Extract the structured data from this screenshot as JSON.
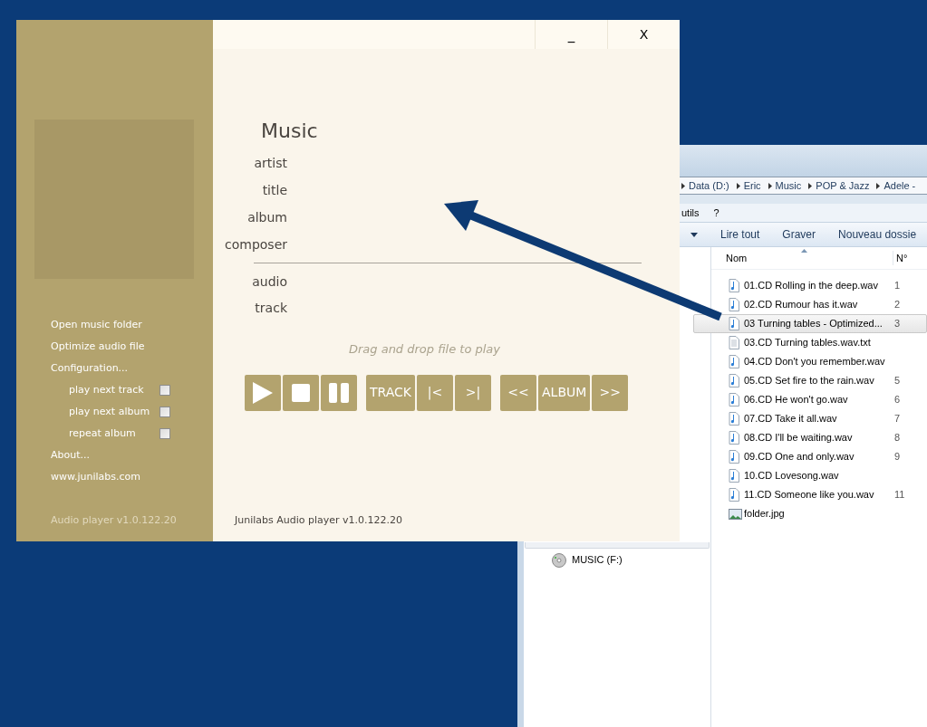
{
  "explorer": {
    "breadcrumb": [
      "Data (D:)",
      "Eric",
      "Music",
      "POP & Jazz",
      "Adele -"
    ],
    "menu": [
      "utils",
      "?"
    ],
    "toolbar": [
      {
        "kind": "dropdown"
      },
      {
        "kind": "text",
        "label": "Lire tout"
      },
      {
        "kind": "text",
        "label": "Graver"
      },
      {
        "kind": "text",
        "label": "Nouveau dossie"
      }
    ],
    "columns": [
      "Nom",
      "N°"
    ],
    "files": [
      {
        "name": "01.CD Rolling in the deep.wav",
        "number": "1",
        "kind": "audio",
        "selected": false
      },
      {
        "name": "02.CD Rumour has it.wav",
        "number": "2",
        "kind": "audio",
        "selected": false
      },
      {
        "name": "03 Turning tables - Optimized...",
        "number": "3",
        "kind": "audio",
        "selected": true
      },
      {
        "name": "03.CD Turning tables.wav.txt",
        "kind": "text",
        "selected": false
      },
      {
        "name": "04.CD Don't you remember.wav",
        "kind": "audio",
        "selected": false
      },
      {
        "name": "05.CD Set fire to the rain.wav",
        "number": "5",
        "kind": "audio",
        "selected": false
      },
      {
        "name": "06.CD He won't go.wav",
        "number": "6",
        "kind": "audio",
        "selected": false
      },
      {
        "name": "07.CD Take it all.wav",
        "number": "7",
        "kind": "audio",
        "selected": false
      },
      {
        "name": "08.CD I'll be waiting.wav",
        "number": "8",
        "kind": "audio",
        "selected": false
      },
      {
        "name": "09.CD One and only.wav",
        "number": "9",
        "kind": "audio",
        "selected": false
      },
      {
        "name": "10.CD Lovesong.wav",
        "kind": "audio",
        "selected": false
      },
      {
        "name": "11.CD Someone like you.wav",
        "number": "11",
        "kind": "audio",
        "selected": false
      },
      {
        "name": "folder.jpg",
        "kind": "image",
        "selected": false
      }
    ],
    "nav_items": [
      {
        "label": "MUSIC (F:)",
        "kind": "disc",
        "selected": false
      }
    ]
  },
  "player": {
    "window_controls": [
      "_",
      "X"
    ],
    "sidebar": {
      "menu": [
        {
          "label": "Open music folder",
          "kind": "link"
        },
        {
          "label": "Optimize audio file",
          "kind": "link"
        },
        {
          "label": "Configuration...",
          "kind": "link"
        },
        {
          "label": "play next track",
          "kind": "option",
          "checked": false
        },
        {
          "label": "play next album",
          "kind": "option",
          "checked": false
        },
        {
          "label": "repeat album",
          "kind": "option",
          "checked": false
        },
        {
          "label": "About...",
          "kind": "link"
        },
        {
          "label": "www.junilabs.com",
          "kind": "link"
        }
      ],
      "version": "Audio player v1.0.122.20"
    },
    "heading": "Music",
    "tag_fields": [
      "artist",
      "title",
      "album",
      "composer"
    ],
    "info_fields": [
      "audio",
      "track"
    ],
    "hint": "Drag and drop file to play",
    "controls": [
      [
        {
          "kind": "play"
        },
        {
          "kind": "stop"
        },
        {
          "kind": "pause"
        }
      ],
      [
        {
          "kind": "text",
          "label": "TRACK"
        },
        {
          "kind": "text",
          "label": "|<"
        },
        {
          "kind": "text",
          "label": ">|"
        }
      ],
      [
        {
          "kind": "text",
          "label": "<<"
        },
        {
          "kind": "text",
          "label": "ALBUM"
        },
        {
          "kind": "text",
          "label": ">>"
        }
      ]
    ],
    "footer": "Junilabs Audio player v1.0.122.20"
  }
}
